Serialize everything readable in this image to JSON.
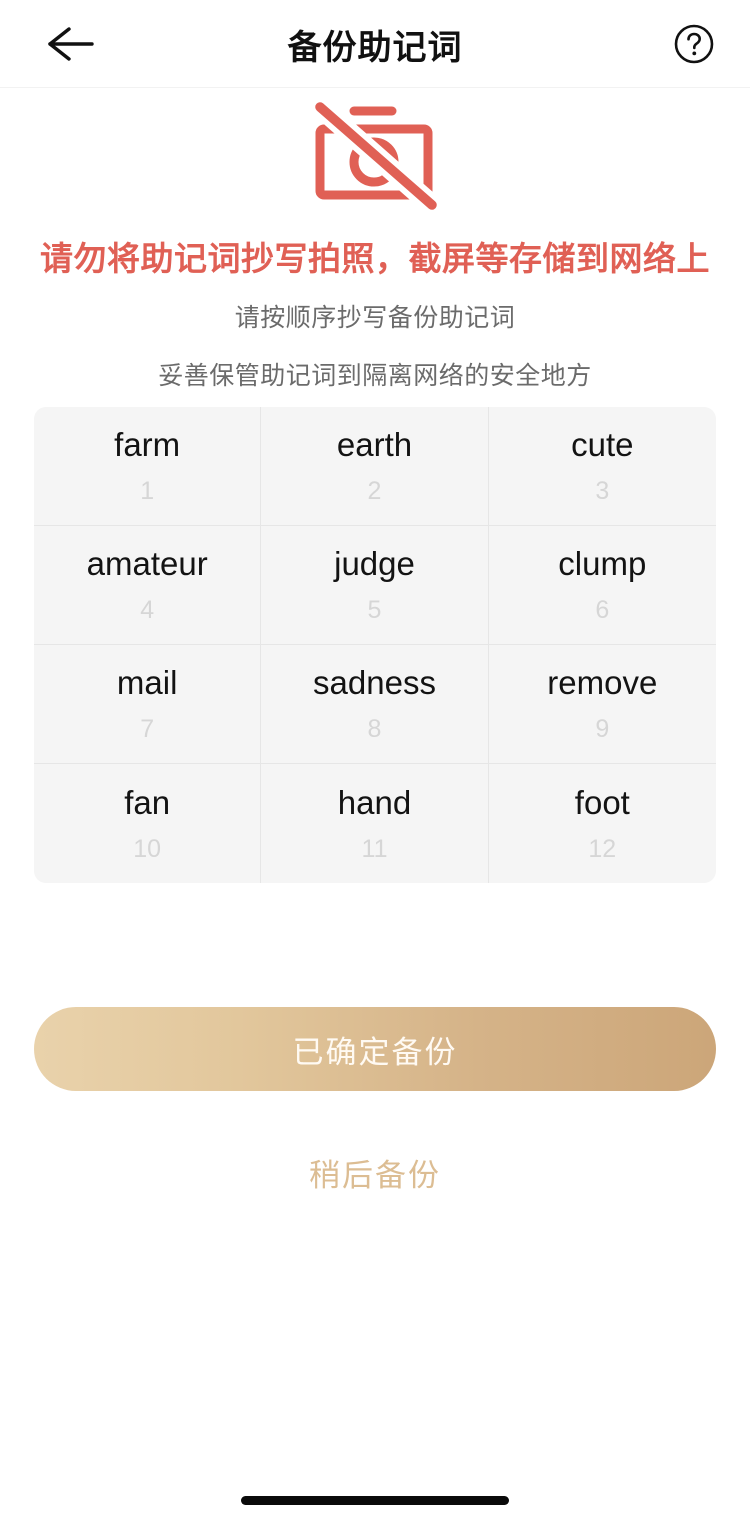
{
  "header": {
    "title": "备份助记词",
    "back_icon": "arrow-left-icon",
    "help_icon": "question-circle-icon"
  },
  "notice": {
    "icon": "no-camera-icon",
    "icon_color": "#e06055",
    "warning": "请勿将助记词抄写拍照，截屏等存储到网络上",
    "subtitle_1": "请按顺序抄写备份助记词",
    "subtitle_2": "妥善保管助记词到隔离网络的安全地方"
  },
  "mnemonic": {
    "words": [
      {
        "index": "1",
        "word": "farm"
      },
      {
        "index": "2",
        "word": "earth"
      },
      {
        "index": "3",
        "word": "cute"
      },
      {
        "index": "4",
        "word": "amateur"
      },
      {
        "index": "5",
        "word": "judge"
      },
      {
        "index": "6",
        "word": "clump"
      },
      {
        "index": "7",
        "word": "mail"
      },
      {
        "index": "8",
        "word": "sadness"
      },
      {
        "index": "9",
        "word": "remove"
      },
      {
        "index": "10",
        "word": "fan"
      },
      {
        "index": "11",
        "word": "hand"
      },
      {
        "index": "12",
        "word": "foot"
      }
    ]
  },
  "actions": {
    "primary_label": "已确定备份",
    "secondary_label": "稍后备份",
    "primary_gradient_start": "#e9d2ab",
    "primary_gradient_end": "#cca679",
    "secondary_color": "#dcbd93"
  }
}
